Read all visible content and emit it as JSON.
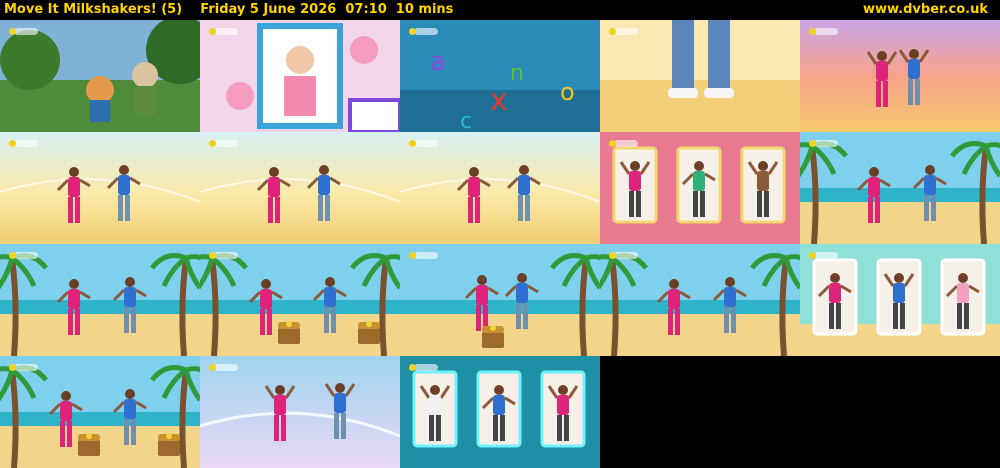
{
  "header": {
    "programme": "Move It Milkshakers! (5)",
    "broadcast": "Friday 5 June 2026  07:10  10 mins",
    "site": "www.dvber.co.uk"
  },
  "colors": {
    "header_text": "#ffd400",
    "background": "#000000"
  },
  "thumbnails": [
    {
      "scene": "cartoon-forest"
    },
    {
      "scene": "peppa-photo-frame"
    },
    {
      "scene": "underwater-letters"
    },
    {
      "scene": "legs-closeup"
    },
    {
      "scene": "sunset-dancers"
    },
    {
      "scene": "desert-dancers"
    },
    {
      "scene": "desert-dancers"
    },
    {
      "scene": "desert-dancers"
    },
    {
      "scene": "kids-panels"
    },
    {
      "scene": "beach-dancers"
    },
    {
      "scene": "beach-dancers"
    },
    {
      "scene": "beach-treasure"
    },
    {
      "scene": "beach-treasure-close"
    },
    {
      "scene": "beach-dancers"
    },
    {
      "scene": "beach-kids-panels"
    },
    {
      "scene": "beach-treasure"
    },
    {
      "scene": "sky-dancers"
    },
    {
      "scene": "kids-panels-teal"
    }
  ]
}
